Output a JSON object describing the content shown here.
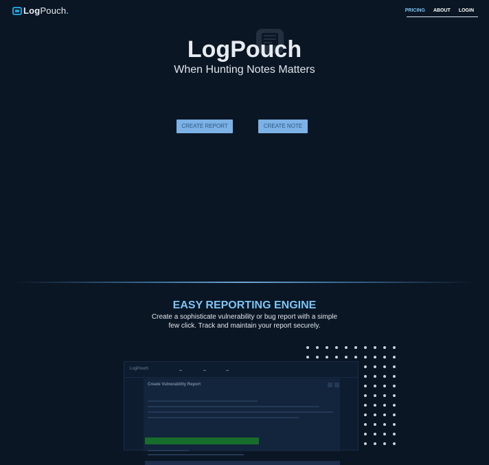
{
  "brand": {
    "name_part1": "Log",
    "name_part2": "Pouch",
    "name_suffix": ".",
    "accent": "#1ea0dc"
  },
  "nav": {
    "items": [
      {
        "label": "PRICING",
        "active": true
      },
      {
        "label": "ABOUT",
        "active": false
      },
      {
        "label": "LOGIN",
        "active": false
      }
    ]
  },
  "hero": {
    "title": "LogPouch",
    "subtitle": "When Hunting Notes Matters",
    "primary_button": "CREATE REPORT",
    "secondary_button": "CREATE NOTE",
    "button_color": "#7cb2e6"
  },
  "feature": {
    "title": "EASY REPORTING ENGINE",
    "description": "Create a sophisticate vulnerability or bug report with a simple few click. Track and maintain your report securely.",
    "title_color": "#7cc4f5"
  },
  "preview": {
    "logo": "LogPouch",
    "page_title": "Create Vulnerability Report"
  },
  "colors": {
    "background": "#0b1624",
    "accent_light": "#7cc4f5"
  }
}
